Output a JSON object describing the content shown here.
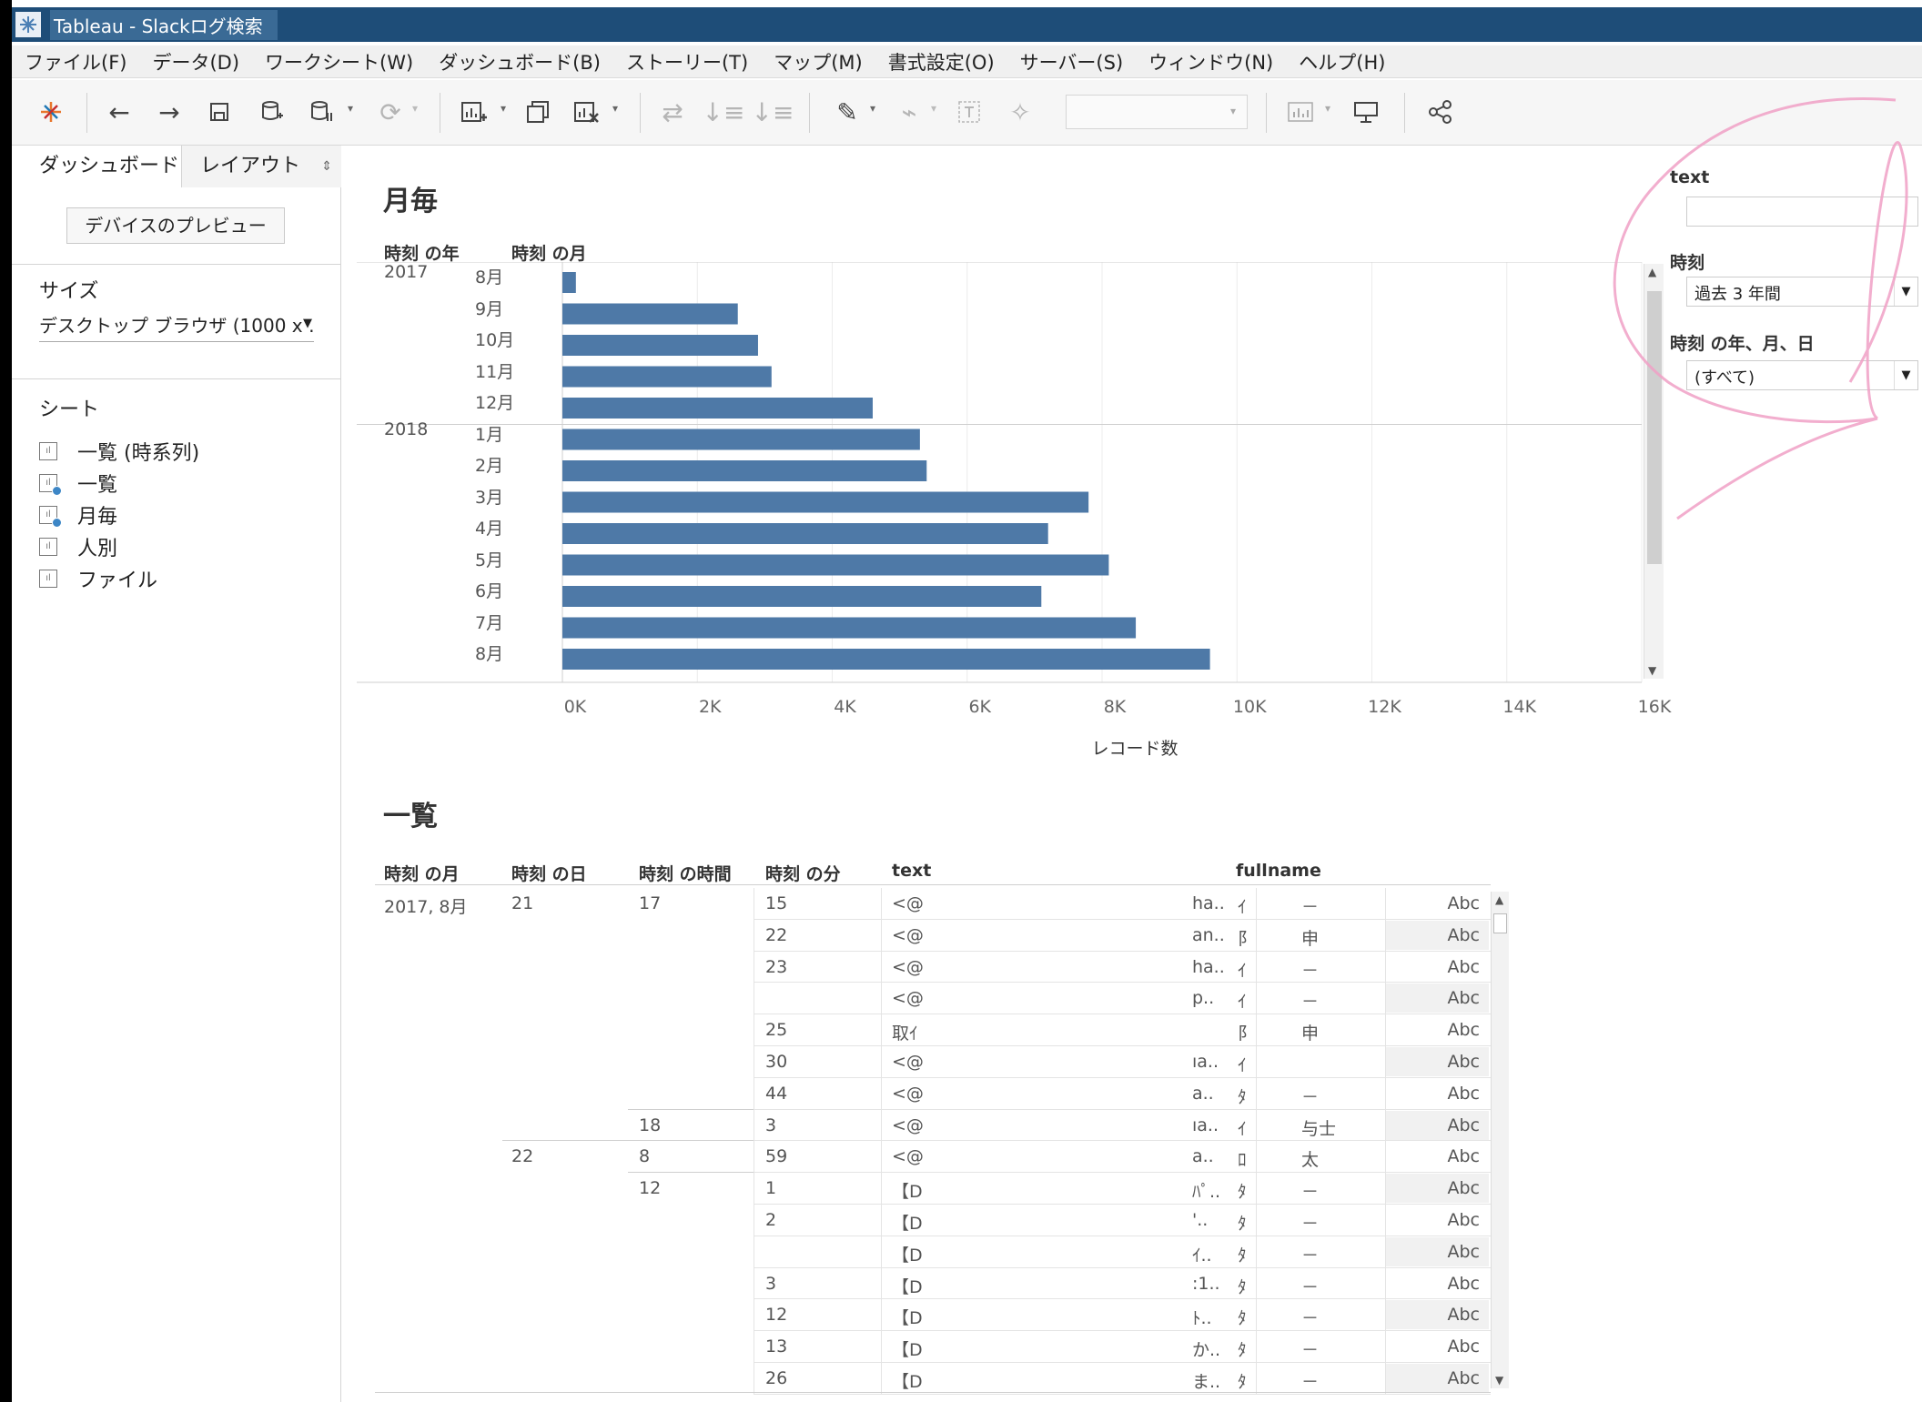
{
  "window": {
    "title": "Tableau - Slackログ検索"
  },
  "menu": [
    "ファイル(F)",
    "データ(D)",
    "ワークシート(W)",
    "ダッシュボード(B)",
    "ストーリー(T)",
    "マップ(M)",
    "書式設定(O)",
    "サーバー(S)",
    "ウィンドウ(N)",
    "ヘルプ(H)"
  ],
  "left_pane": {
    "tab_dashboard": "ダッシュボード",
    "tab_layout": "レイアウト",
    "preview_button": "デバイスのプレビュー",
    "size_heading": "サイズ",
    "size_value": "デスクトップ ブラウザ (1000 x …",
    "sheets_heading": "シート",
    "sheets": [
      "一覧 (時系列)",
      "一覧",
      "月毎",
      "人別",
      "ファイル"
    ]
  },
  "monthly": {
    "title": "月毎",
    "col_year": "時刻 の年",
    "col_month": "時刻 の月",
    "x_axis_title": "レコード数"
  },
  "chart_data": {
    "type": "bar",
    "orientation": "horizontal",
    "title": "月毎",
    "xlabel": "レコード数",
    "ylabel": "",
    "xlim": [
      0,
      16000
    ],
    "x_ticks": [
      "0K",
      "2K",
      "4K",
      "6K",
      "8K",
      "10K",
      "12K",
      "14K",
      "16K"
    ],
    "groups": [
      {
        "year": "2017",
        "months": [
          "8月",
          "9月",
          "10月",
          "11月",
          "12月"
        ],
        "values": [
          200,
          2600,
          2900,
          3100,
          4600
        ]
      },
      {
        "year": "2018",
        "months": [
          "1月",
          "2月",
          "3月",
          "4月",
          "5月",
          "6月",
          "7月",
          "8月"
        ],
        "values": [
          5300,
          5400,
          7800,
          7200,
          8100,
          7100,
          8500,
          9600
        ]
      }
    ],
    "color": "#4e79a7",
    "grid": true
  },
  "list": {
    "title": "一覧",
    "headers": [
      "時刻 の月",
      "時刻 の日",
      "時刻 の時間",
      "時刻 の分",
      "text",
      "fullname"
    ],
    "rows": [
      {
        "month": "2017, 8月",
        "day": "21",
        "hour": "17",
        "minute": "15",
        "text": "<@",
        "user": "ha..",
        "name": "ｲ",
        "dept": "－",
        "abc": "Abc"
      },
      {
        "month": "",
        "day": "",
        "hour": "",
        "minute": "22",
        "text": "<@",
        "user": "an..",
        "name": "阝",
        "dept": "申",
        "abc": "Abc"
      },
      {
        "month": "",
        "day": "",
        "hour": "",
        "minute": "23",
        "text": "<@",
        "user": "ha..",
        "name": "ｲ",
        "dept": "－",
        "abc": "Abc"
      },
      {
        "month": "",
        "day": "",
        "hour": "",
        "minute": "",
        "text": "<@",
        "user": "p..",
        "name": "ｲ",
        "dept": "－",
        "abc": "Abc"
      },
      {
        "month": "",
        "day": "",
        "hour": "",
        "minute": "25",
        "text": "取ｲ",
        "user": "",
        "name": "阝",
        "dept": "申",
        "abc": "Abc"
      },
      {
        "month": "",
        "day": "",
        "hour": "",
        "minute": "30",
        "text": "<@",
        "user": "ıa..",
        "name": "ｲ",
        "dept": "",
        "abc": "Abc"
      },
      {
        "month": "",
        "day": "",
        "hour": "",
        "minute": "44",
        "text": "<@",
        "user": "a..",
        "name": "ﾀ",
        "dept": "－",
        "abc": "Abc"
      },
      {
        "month": "",
        "day": "",
        "hour": "18",
        "minute": "3",
        "text": "<@",
        "user": "ıa..",
        "name": "ｲ",
        "dept": "与士",
        "abc": "Abc"
      },
      {
        "month": "",
        "day": "22",
        "hour": "8",
        "minute": "59",
        "text": "<@",
        "user": "a..",
        "name": "ﾛ",
        "dept": "太",
        "abc": "Abc"
      },
      {
        "month": "",
        "day": "",
        "hour": "12",
        "minute": "1",
        "text": "【D",
        "user": "ﾊﾟ..",
        "name": "ﾀ",
        "dept": "－",
        "abc": "Abc"
      },
      {
        "month": "",
        "day": "",
        "hour": "",
        "minute": "2",
        "text": "【D",
        "user": "'..",
        "name": "ﾀ",
        "dept": "－",
        "abc": "Abc"
      },
      {
        "month": "",
        "day": "",
        "hour": "",
        "minute": "",
        "text": "【D",
        "user": "ｲ..",
        "name": "ﾀ",
        "dept": "－",
        "abc": "Abc"
      },
      {
        "month": "",
        "day": "",
        "hour": "",
        "minute": "3",
        "text": "【D",
        "user": ":1..",
        "name": "ﾀ",
        "dept": "－",
        "abc": "Abc"
      },
      {
        "month": "",
        "day": "",
        "hour": "",
        "minute": "12",
        "text": "【D",
        "user": "ﾄ..",
        "name": "ﾀ",
        "dept": "－",
        "abc": "Abc"
      },
      {
        "month": "",
        "day": "",
        "hour": "",
        "minute": "13",
        "text": "【D",
        "user": "か..",
        "name": "ﾀ",
        "dept": "－",
        "abc": "Abc"
      },
      {
        "month": "",
        "day": "",
        "hour": "",
        "minute": "26",
        "text": "【D",
        "user": "ま..",
        "name": "ﾀ",
        "dept": "－",
        "abc": "Abc"
      }
    ]
  },
  "filters": {
    "text_label": "text",
    "text_value": "",
    "time_label": "時刻",
    "time_value": "過去 3 年間",
    "ymd_label": "時刻 の年、月、日",
    "ymd_value": "(すべて)"
  }
}
